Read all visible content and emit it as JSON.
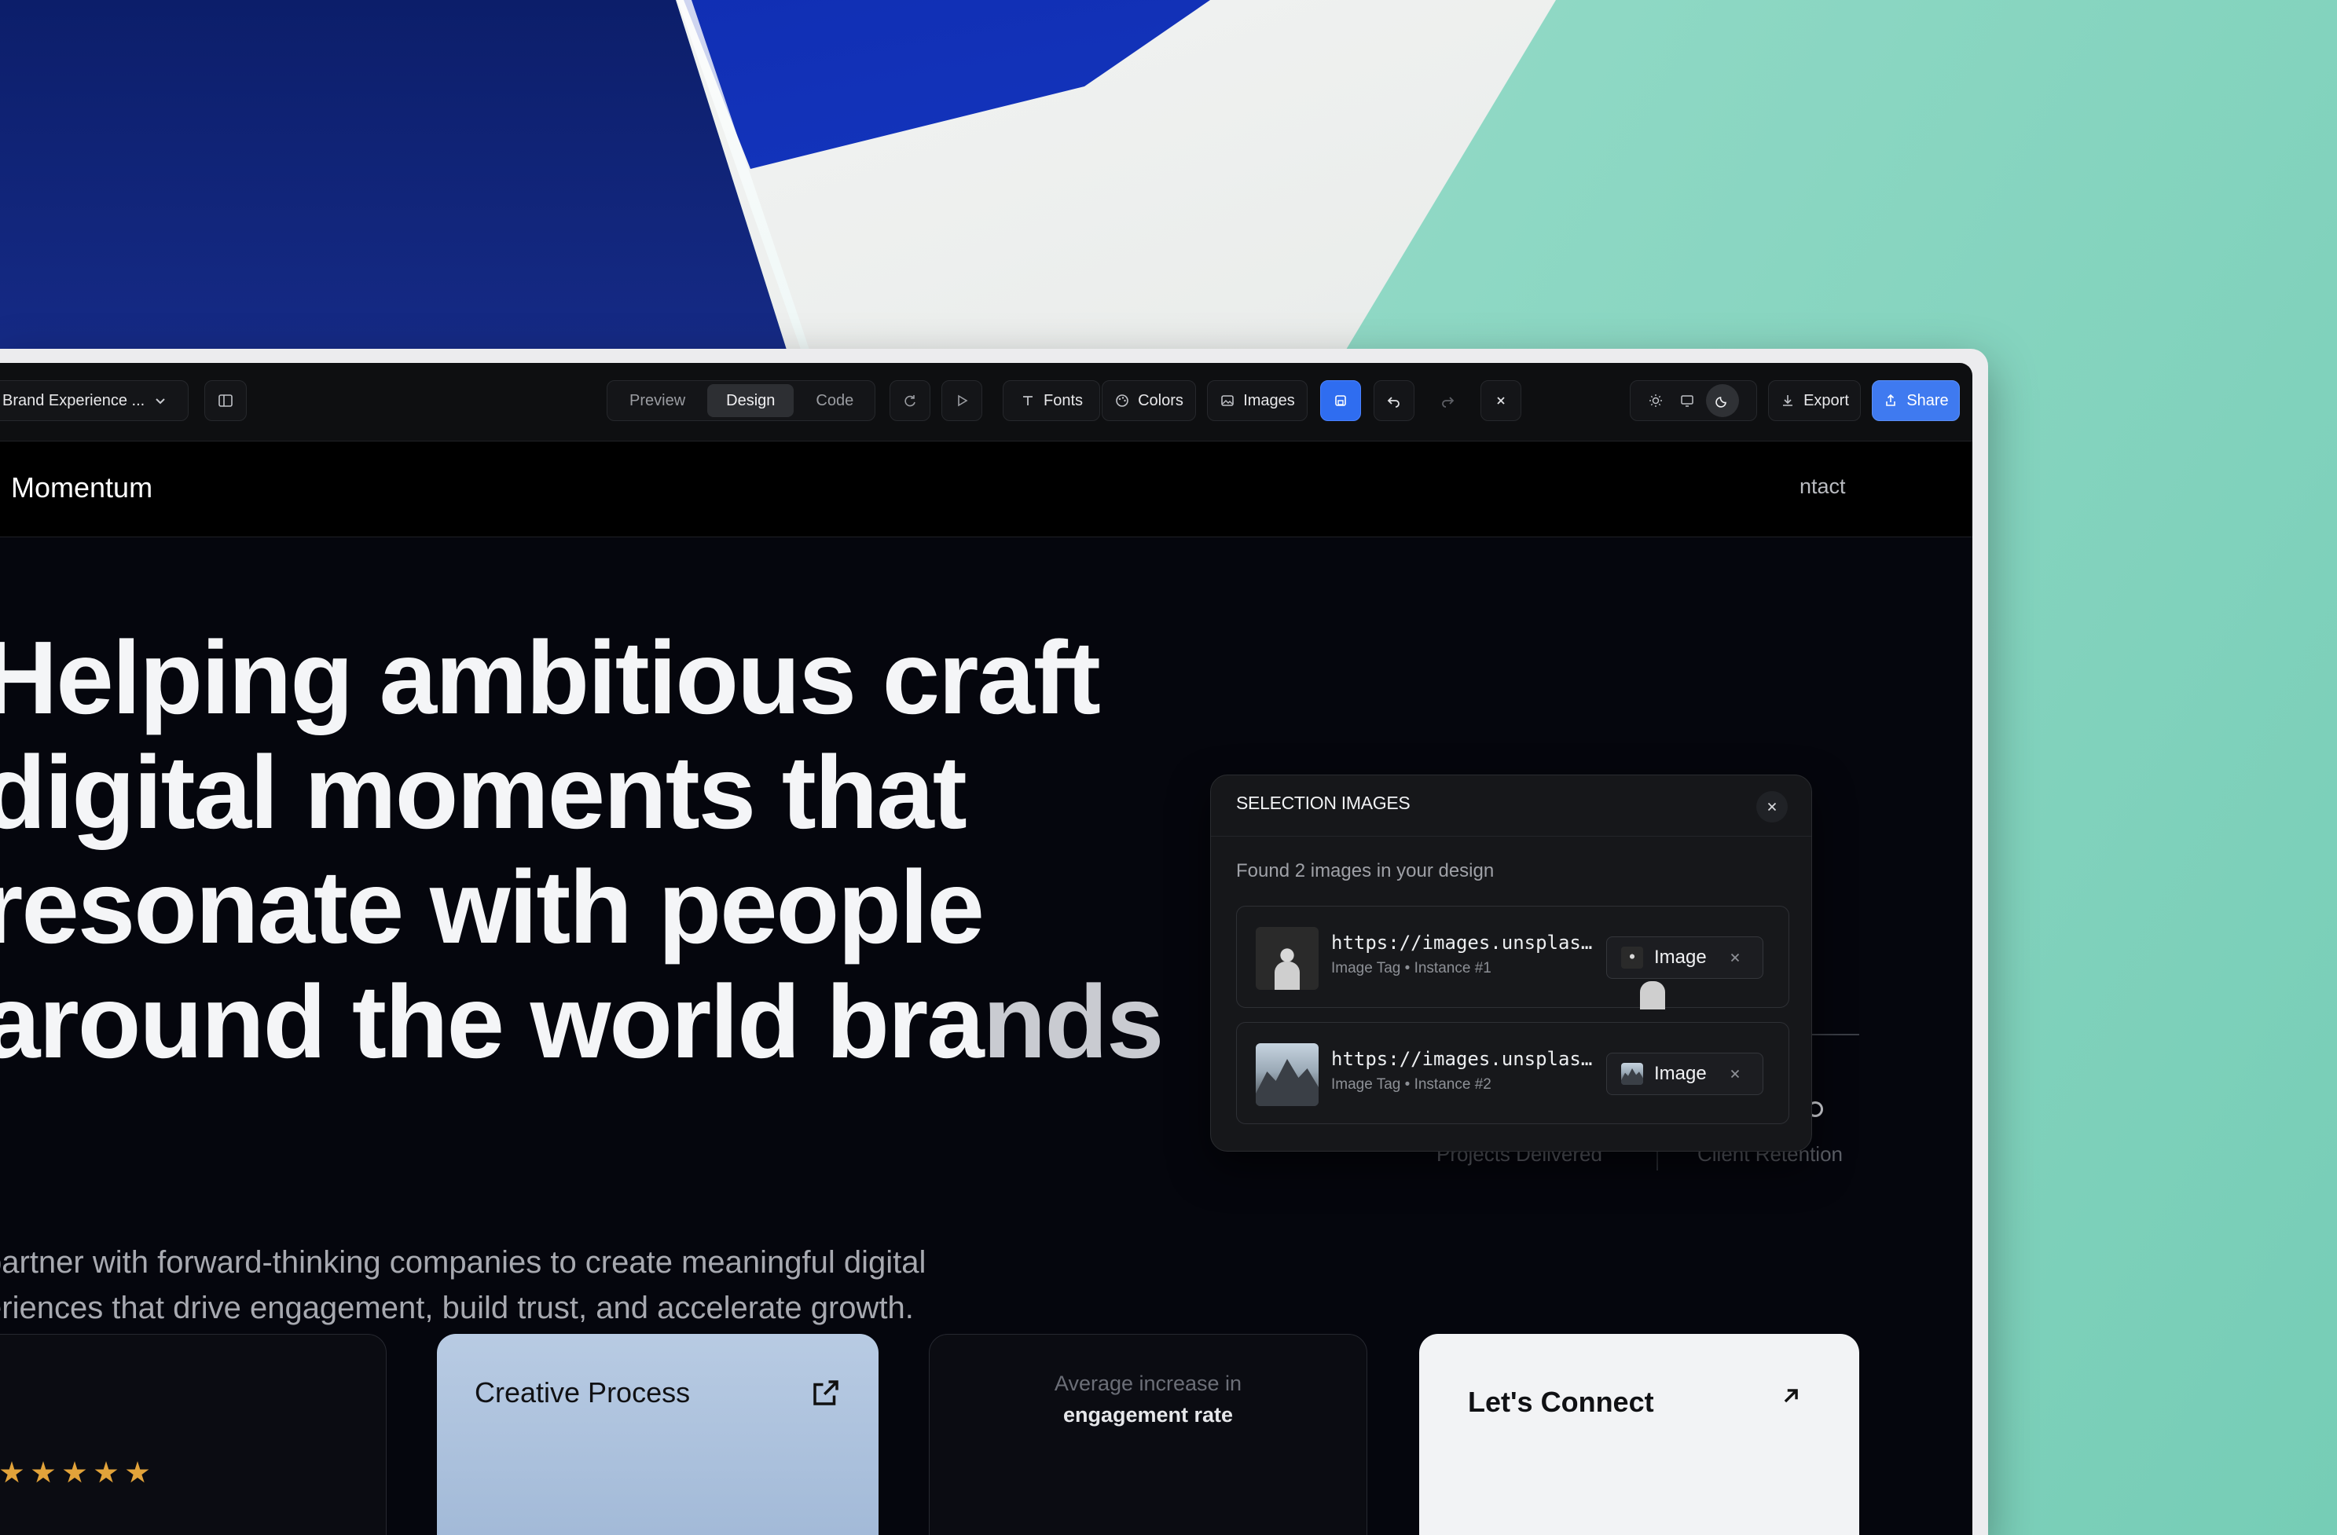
{
  "toolbar": {
    "project_name": "Brand Experience ...",
    "view_tabs": [
      "Preview",
      "Design",
      "Code"
    ],
    "active_tab": "Design",
    "fonts_label": "Fonts",
    "colors_label": "Colors",
    "images_label": "Images",
    "export_label": "Export",
    "share_label": "Share"
  },
  "site": {
    "brand": "Momentum",
    "nav_contact": "ntact",
    "hero_lines": [
      "Helping ambitious craft",
      "digital moments that",
      "resonate with people"
    ],
    "hero_last_main": "around the world bra",
    "hero_last_fade": "nds",
    "hero_sub_1": "partner with forward-thinking companies to create meaningful digital",
    "hero_sub_2": "eriences that drive engagement, build trust, and accelerate growth.",
    "stat_projects": "Projects Delivered",
    "stat_retention": "Client Retention",
    "card_creative": "Creative Process",
    "card_avg": "Average increase in",
    "card_engagement": "engagement rate",
    "card_connect": "Let's Connect"
  },
  "popover": {
    "title": "SELECTION IMAGES",
    "subtitle": "Found 2 images in your design",
    "images": [
      {
        "url": "https://images.unsplash.com/",
        "meta": "Image Tag • Instance #1",
        "chip": "Image"
      },
      {
        "url": "https://images.unsplash.com/",
        "meta": "Image Tag • Instance #2",
        "chip": "Image"
      }
    ]
  },
  "colors": {
    "accent": "#3f7af0",
    "star": "#e2a33a"
  }
}
